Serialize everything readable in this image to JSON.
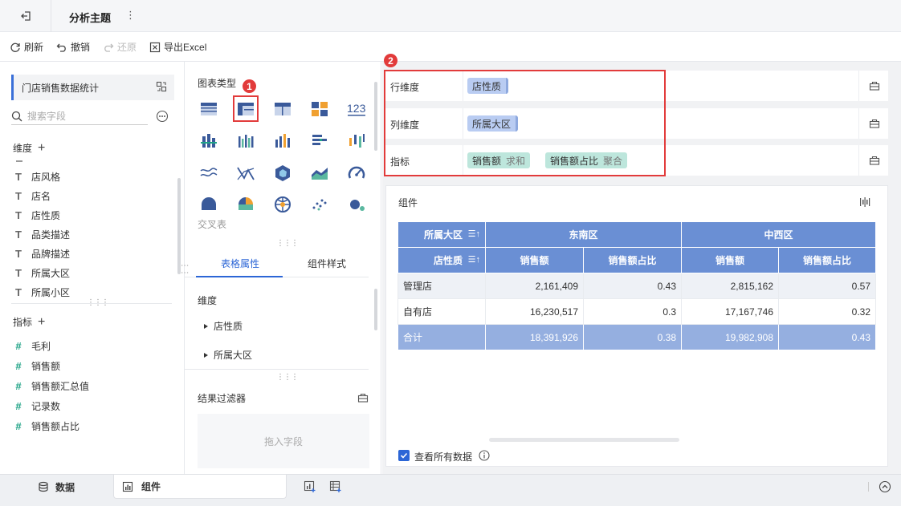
{
  "app": {
    "title": "分析主题",
    "more": "⋮"
  },
  "toolbar": {
    "refresh": "刷新",
    "undo": "撤销",
    "redo": "还原",
    "export": "导出Excel"
  },
  "left": {
    "dataset": "门店销售数据统计",
    "search_placeholder": "搜索字段",
    "dim_header": "维度",
    "dimensions": [
      "店风格",
      "店名",
      "店性质",
      "品类描述",
      "品牌描述",
      "所属大区",
      "所属小区"
    ],
    "metric_header": "指标",
    "metrics": [
      "毛利",
      "销售额",
      "销售额汇总值",
      "记录数",
      "销售额占比"
    ]
  },
  "middle": {
    "chart_type_label": "图表类型",
    "chart_type_selected": "交叉表",
    "tabs": [
      "表格属性",
      "组件样式"
    ],
    "dim_label": "维度",
    "dim_items": [
      "店性质",
      "所属大区"
    ],
    "filter_label": "结果过滤器",
    "drop_hint": "拖入字段"
  },
  "shelves": {
    "row_label": "行维度",
    "row_fields": [
      "店性质"
    ],
    "col_label": "列维度",
    "col_fields": [
      "所属大区"
    ],
    "metric_label": "指标",
    "metric_fields": [
      {
        "name": "销售额",
        "agg": "求和"
      },
      {
        "name": "销售额占比",
        "agg": "聚合"
      }
    ]
  },
  "badges": [
    "1",
    "2"
  ],
  "component": {
    "title": "组件",
    "header_row1": [
      "所属大区",
      "东南区",
      "中西区"
    ],
    "header_row2": [
      "店性质",
      "销售额",
      "销售额占比",
      "销售额",
      "销售额占比"
    ],
    "rows": [
      [
        "管理店",
        "2,161,409",
        "0.43",
        "2,815,162",
        "0.57"
      ],
      [
        "自有店",
        "16,230,517",
        "0.3",
        "17,167,746",
        "0.32"
      ]
    ],
    "total": [
      "合计",
      "18,391,926",
      "0.38",
      "19,982,908",
      "0.43"
    ],
    "view_all": "查看所有数据"
  },
  "bottom": {
    "tab_data": "数据",
    "tab_component": "组件"
  },
  "colors": {
    "accent": "#2c66d6",
    "highlight": "#e23b3b",
    "header": "#6a8fd4",
    "total": "#95afe0"
  }
}
